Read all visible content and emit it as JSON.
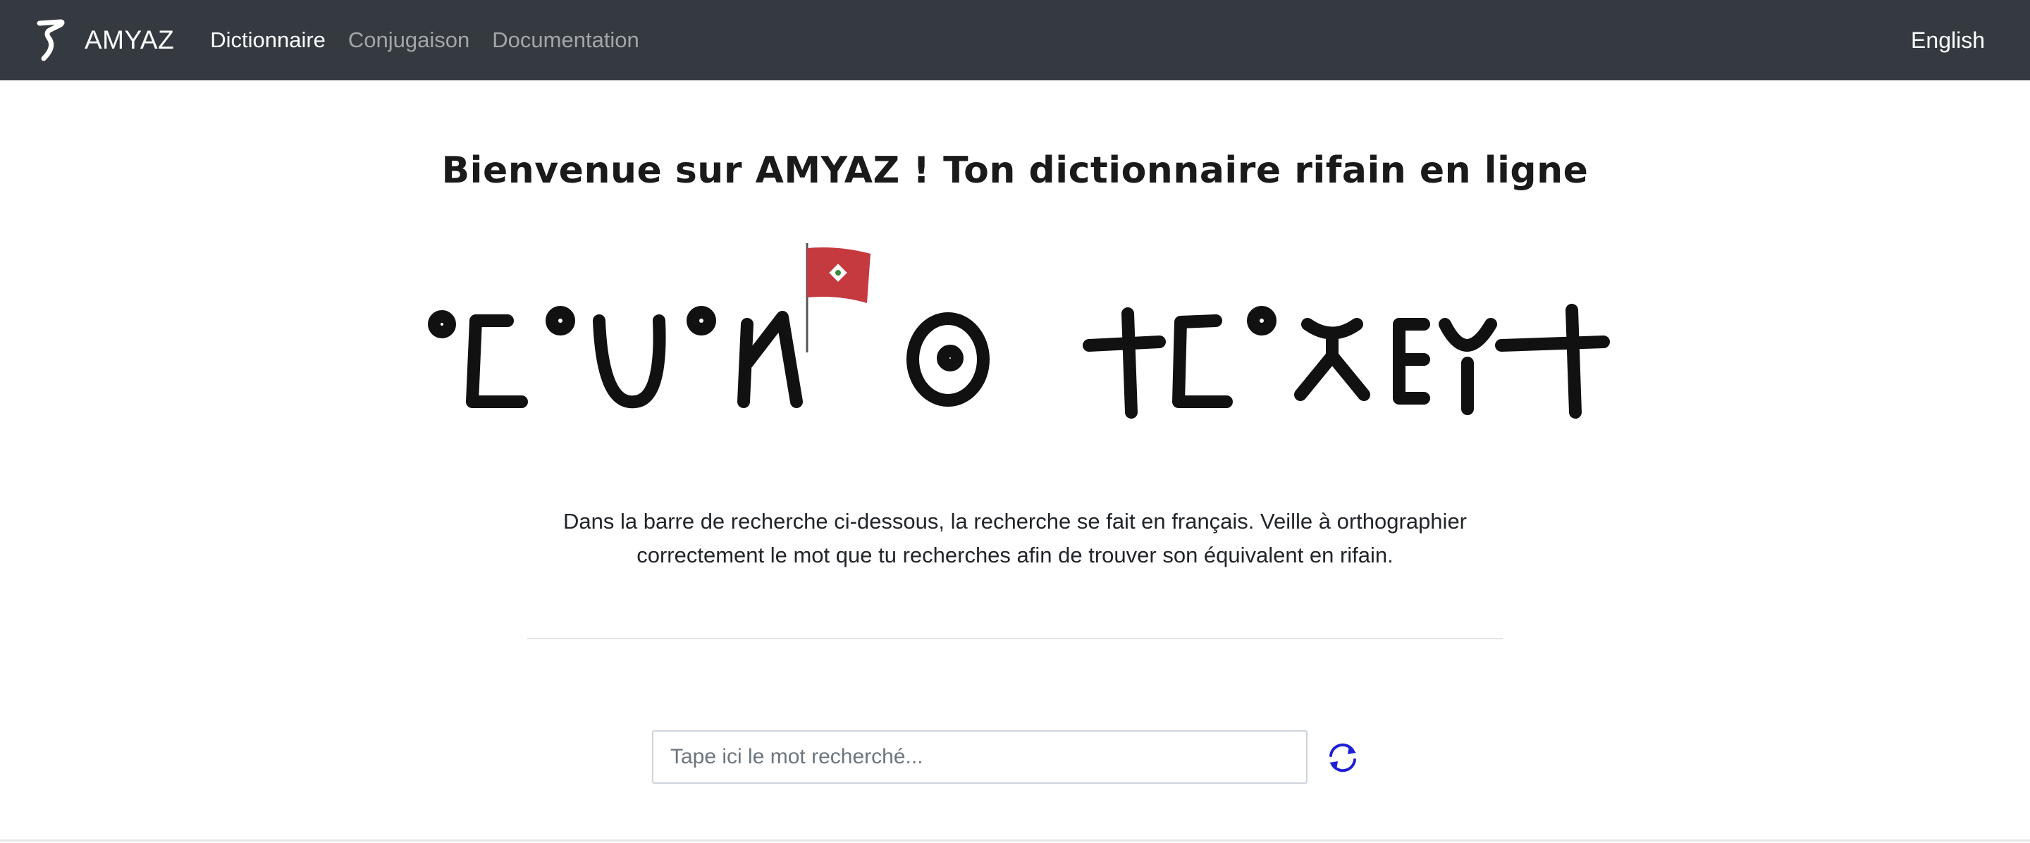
{
  "navbar": {
    "brand_name": "AMYAZ",
    "links": [
      {
        "label": "Dictionnaire",
        "active": true
      },
      {
        "label": "Conjugaison",
        "active": false
      },
      {
        "label": "Documentation",
        "active": false
      }
    ],
    "language_switch": "English"
  },
  "main": {
    "title": "Bienvenue sur AMYAZ ! Ton dictionnaire rifain en ligne",
    "intro_line_1": "Dans la barre de recherche ci-dessous, la recherche se fait en français. Veille à orthographier",
    "intro_line_2": "correctement le mot que tu recherches afin de trouver son équivalent en rifain.",
    "search": {
      "placeholder": "Tape ici le mot recherché...",
      "value": ""
    }
  },
  "colors": {
    "navbar_bg": "#343a40",
    "refresh_icon": "#1f1fd6",
    "flag_red": "#c43a3f"
  },
  "icons": {
    "brand": "amyaz-logo-icon",
    "refresh": "refresh-icon",
    "flag": "rif-flag-icon"
  }
}
